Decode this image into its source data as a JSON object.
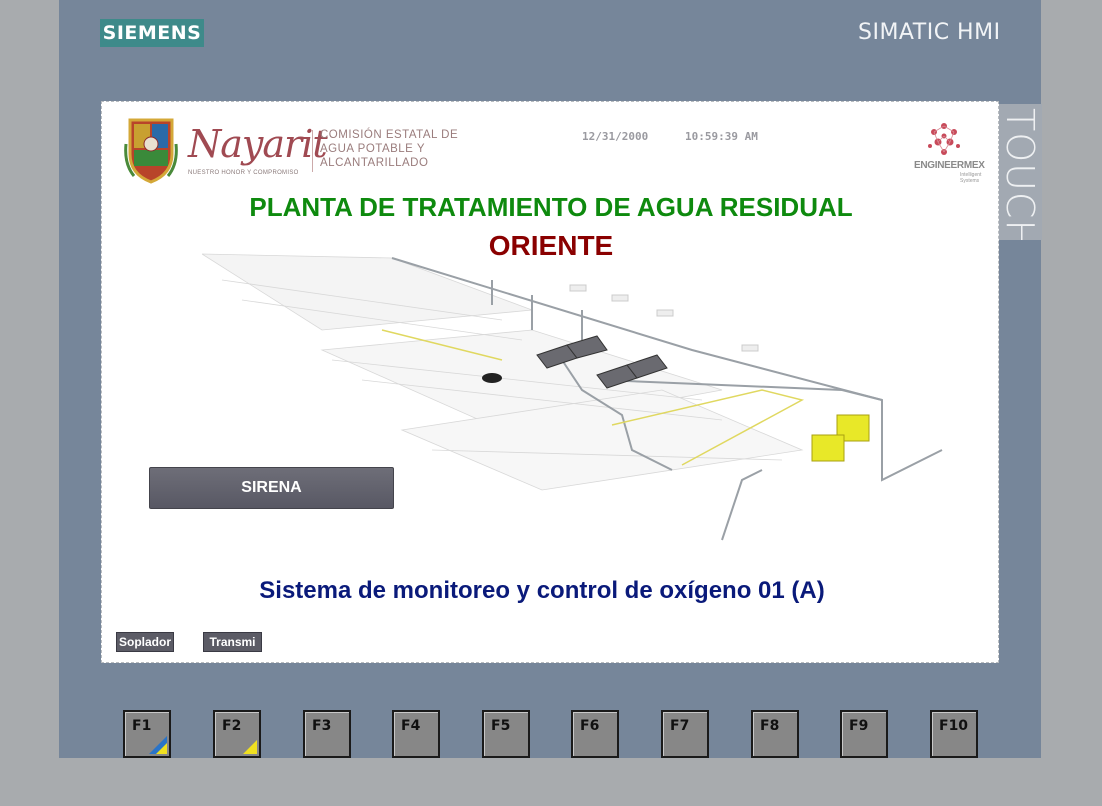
{
  "bezel": {
    "brand": "SIEMENS",
    "product": "SIMATIC HMI",
    "side_label": "TOUCH"
  },
  "header": {
    "org_name": "Nayarit",
    "org_motto": "NUESTRO HONOR Y COMPROMISO",
    "agency_line1": "COMISIÓN ESTATAL DE",
    "agency_line2": "AGUA POTABLE Y",
    "agency_line3": "ALCANTARILLADO",
    "date": "12/31/2000",
    "time": "10:59:39 AM",
    "partner": "ENGINEERMEX",
    "partner_tagline": "Intelligent Systems"
  },
  "titles": {
    "main": "PLANTA DE TRATAMIENTO DE AGUA RESIDUAL",
    "location": "ORIENTE",
    "subtitle": "Sistema de monitoreo y control de oxígeno 01 (A)"
  },
  "buttons": {
    "sirena": "SIRENA",
    "soplador": "Soplador",
    "transmi": "Transmi"
  },
  "function_keys": [
    {
      "label": "F1",
      "corner": "blue-yellow"
    },
    {
      "label": "F2",
      "corner": "yellow"
    },
    {
      "label": "F3"
    },
    {
      "label": "F4"
    },
    {
      "label": "F5"
    },
    {
      "label": "F6"
    },
    {
      "label": "F7"
    },
    {
      "label": "F8"
    },
    {
      "label": "F9"
    },
    {
      "label": "F10"
    }
  ],
  "colors": {
    "title_green": "#0e8a0e",
    "location_red": "#8a0000",
    "subtitle_navy": "#0a1a7a",
    "siemens_teal": "#3e8a8a",
    "bezel": "#76869a"
  },
  "icons": {
    "crest": "coat-of-arms-icon",
    "partner_logo": "molecule-logo-icon"
  }
}
